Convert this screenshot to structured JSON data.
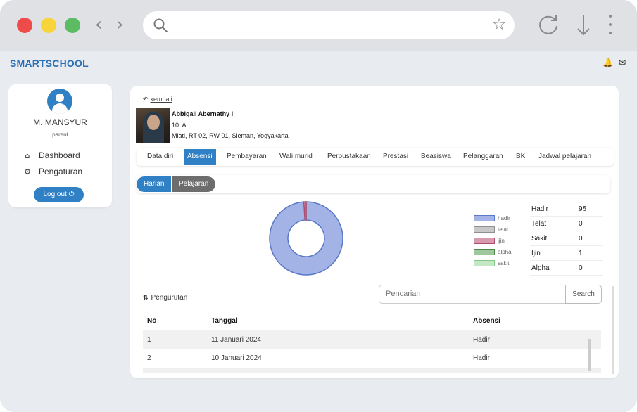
{
  "browser": {
    "back_arrow": "‹",
    "forward_arrow": "›",
    "star_icon": "star-icon"
  },
  "app": {
    "brand": "SMARTSCHOOL",
    "icons": [
      "bell-icon",
      "mail-icon"
    ]
  },
  "sidebar": {
    "user_name": "M. MANSYUR",
    "user_role": "parent",
    "items": [
      {
        "label": "Dashboard",
        "icon": "home-icon"
      },
      {
        "label": "Pengaturan",
        "icon": "settings-icon"
      }
    ],
    "logout_label": "Log out"
  },
  "main": {
    "back_label": "kembali",
    "student": {
      "name": "Abbigail Abernathy I",
      "class": "10. A",
      "address": "Mlati, RT 02, RW 01, Sleman, Yogyakarta"
    },
    "tabs": [
      "Data diri",
      "Absensi",
      "Pembayaran",
      "Wali murid",
      "Perpustakaan",
      "Prestasi",
      "Beasiswa",
      "Pelanggaran",
      "BK",
      "Jadwal pelajaran"
    ],
    "active_tab": "Absensi",
    "subtabs": [
      "Harian",
      "Pelajaran"
    ],
    "active_subtab": "Harian",
    "sort_label": "Pengurutan",
    "search_placeholder": "Pencarian",
    "search_button": "Search",
    "table": {
      "headers": [
        "No",
        "Tanggal",
        "Absensi"
      ],
      "rows": [
        [
          "1",
          "11 Januari 2024",
          "Hadir"
        ],
        [
          "2",
          "10 Januari 2024",
          "Hadir"
        ]
      ]
    }
  },
  "chart_data": {
    "type": "pie",
    "title": "",
    "categories": [
      "hadir",
      "telat",
      "ijin",
      "alpha",
      "sakit"
    ],
    "values": [
      95,
      0,
      1,
      0,
      0
    ],
    "colors": [
      "#a3b3e6",
      "#c8c8c8",
      "#d89aae",
      "#9fc79c",
      "#c4e8c4"
    ],
    "stroke_colors": [
      "#5a78c8",
      "#8f8f8f",
      "#b04d6d",
      "#4d8a4a",
      "#86c886"
    ],
    "legend_position": "right"
  },
  "stats": [
    {
      "label": "Hadir",
      "value": "95"
    },
    {
      "label": "Telat",
      "value": "0"
    },
    {
      "label": "Sakit",
      "value": "0"
    },
    {
      "label": "Ijin",
      "value": "1"
    },
    {
      "label": "Alpha",
      "value": "0"
    }
  ]
}
